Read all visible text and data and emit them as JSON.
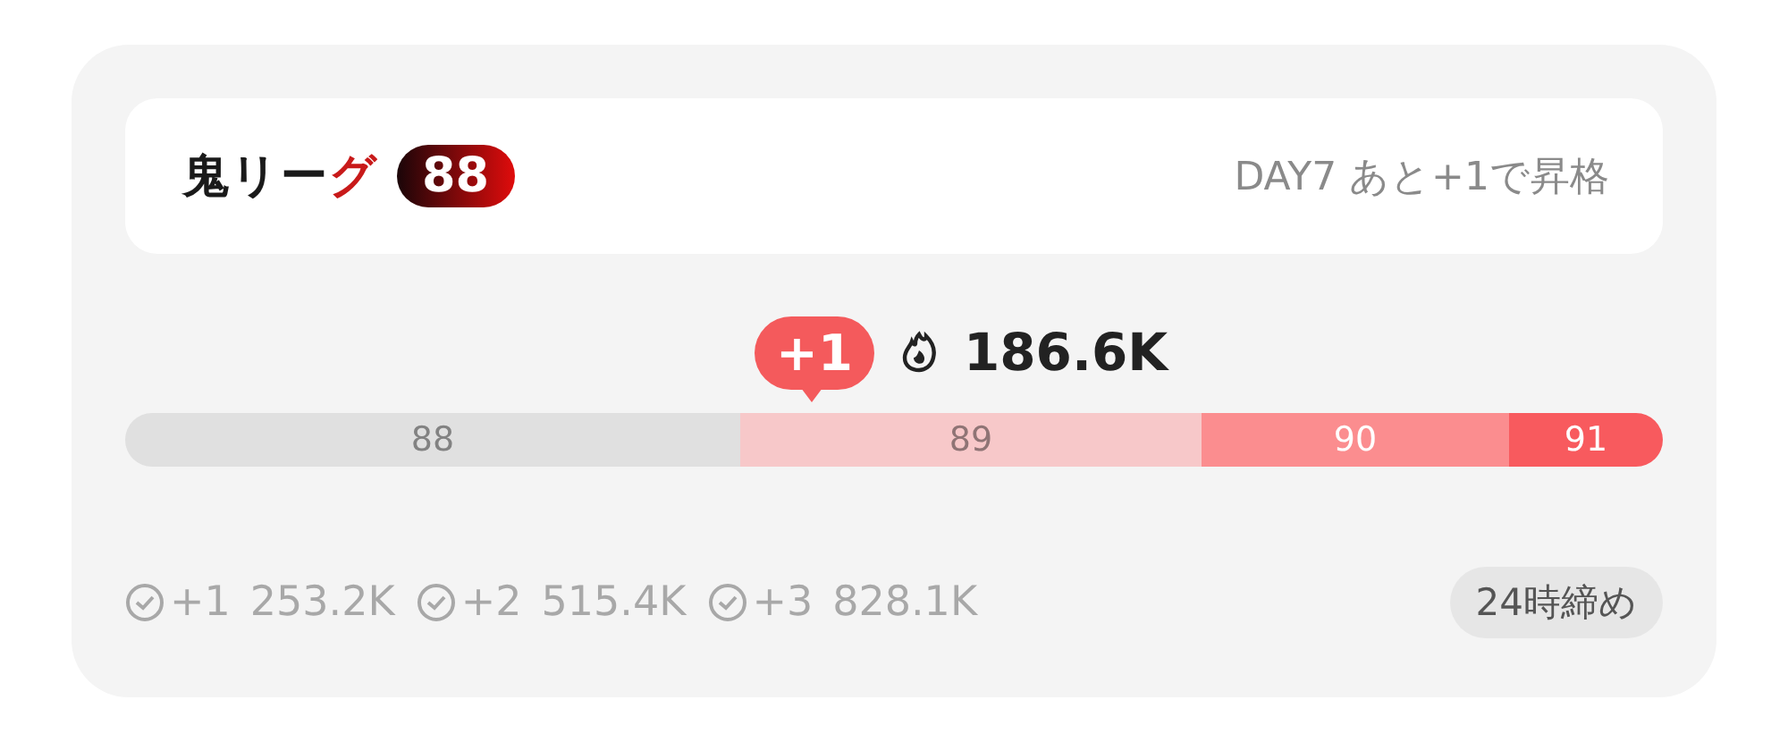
{
  "header": {
    "title_prefix": "鬼リー",
    "title_accent": "グ",
    "rank": "88",
    "status": "DAY7 あと+1で昇格"
  },
  "marker": {
    "badge": "+1",
    "score": "186.6K"
  },
  "segments": [
    {
      "label": "88",
      "color": "#e0e0e0"
    },
    {
      "label": "89",
      "color": "#f7c8c9"
    },
    {
      "label": "90",
      "color": "#fb8d8f"
    },
    {
      "label": "91",
      "color": "#f85a5e"
    }
  ],
  "thresholds": [
    {
      "rank": "+1",
      "score": "253.2K"
    },
    {
      "rank": "+2",
      "score": "515.4K"
    },
    {
      "rank": "+3",
      "score": "828.1K"
    }
  ],
  "deadline": "24時締め"
}
